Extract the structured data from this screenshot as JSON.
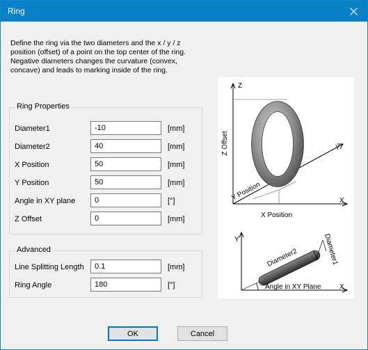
{
  "window": {
    "title": "Ring"
  },
  "description": "Define the ring via the two diameters and the x / y / z position (offset) of a point on the top center of the ring. Negative diameters changes the curvature (convex, concave) and leads to marking inside of the ring.",
  "ring_properties": {
    "group_label": "Ring Properties",
    "fields": [
      {
        "label": "Diameter1",
        "value": "-10",
        "unit": "[mm]"
      },
      {
        "label": "Diameter2",
        "value": "40",
        "unit": "[mm]"
      },
      {
        "label": "X Position",
        "value": "50",
        "unit": "[mm]"
      },
      {
        "label": "Y Position",
        "value": "50",
        "unit": "[mm]"
      },
      {
        "label": "Angle in XY plane",
        "value": "0",
        "unit": "[°]"
      },
      {
        "label": "Z Offset",
        "value": "0",
        "unit": "[mm]"
      }
    ]
  },
  "advanced": {
    "group_label": "Advanced",
    "fields": [
      {
        "label": "Line Splitting Length",
        "value": "0.1",
        "unit": "[mm]"
      },
      {
        "label": "Ring Angle",
        "value": "180",
        "unit": "[°]"
      }
    ]
  },
  "diagram": {
    "top": {
      "z_axis": "Z",
      "z_offset": "Z Offset",
      "y_axis": "Y",
      "x_axis": "X",
      "y_position": "Y Position",
      "x_position": "X Position"
    },
    "bottom": {
      "y_axis": "Y",
      "x_axis": "X",
      "diameter1": "Diameter1",
      "diameter2": "Diameter2",
      "angle": "Angle in XY Plane"
    }
  },
  "buttons": {
    "ok": "OK",
    "cancel": "Cancel"
  }
}
